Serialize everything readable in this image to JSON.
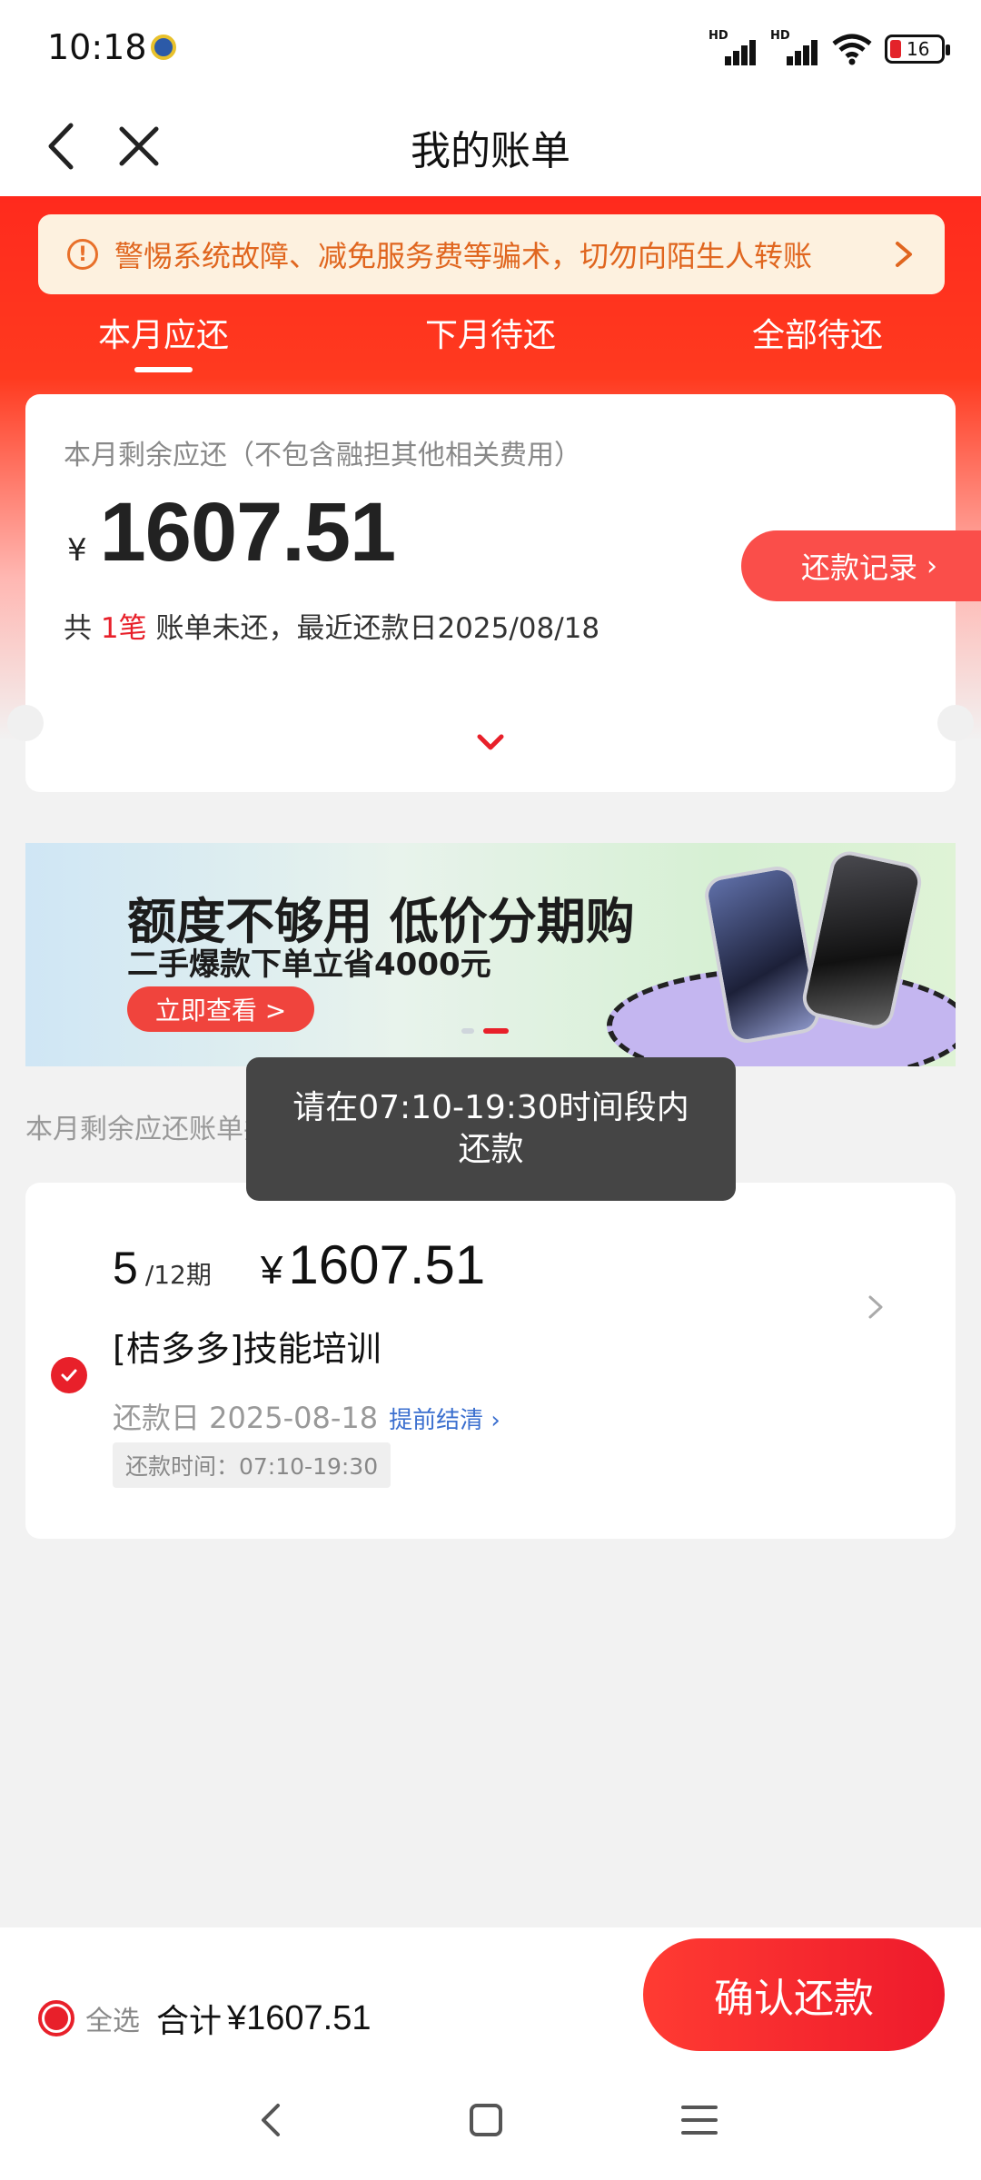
{
  "status_bar": {
    "time": "10:18",
    "signal_label": "HD",
    "battery": "16"
  },
  "nav": {
    "title": "我的账单"
  },
  "warning": {
    "text": "警惕系统故障、减免服务费等骗术，切勿向陌生人转账"
  },
  "tabs": [
    {
      "label": "本月应还",
      "active": true
    },
    {
      "label": "下月待还",
      "active": false
    },
    {
      "label": "全部待还",
      "active": false
    }
  ],
  "summary": {
    "label": "本月剩余应还（不包含融担其他相关费用）",
    "currency": "¥",
    "amount": "1607.51",
    "bill_prefix": "共",
    "bill_count": "1笔",
    "bill_suffix": "账单未还，最近还款日2025/08/18",
    "record_button": "还款记录"
  },
  "banner": {
    "title": "额度不够用 低价分期购",
    "subtitle": "二手爆款下单立省4000元",
    "button": "立即查看 >",
    "slide_count": 2,
    "active_slide": 2
  },
  "section_label": "本月剩余应还账单共有1笔",
  "toast": "请在07:10-19:30时间段内还款",
  "bill_item": {
    "period": "5",
    "period_total": "/12期",
    "currency": "¥",
    "amount": "1607.51",
    "name": "[桔多多]技能培训",
    "due_date": "还款日 2025-08-18",
    "early_payoff": "提前结清",
    "time_window": "还款时间：07:10-19:30",
    "selected": true
  },
  "bottom": {
    "select_all": "全选",
    "total_label": "合计",
    "total_amount": "¥1607.51",
    "confirm_button": "确认还款"
  },
  "colors": {
    "brand_red": "#e8202a",
    "warning_orange": "#e0661f",
    "link_blue": "#3b6fcf"
  }
}
